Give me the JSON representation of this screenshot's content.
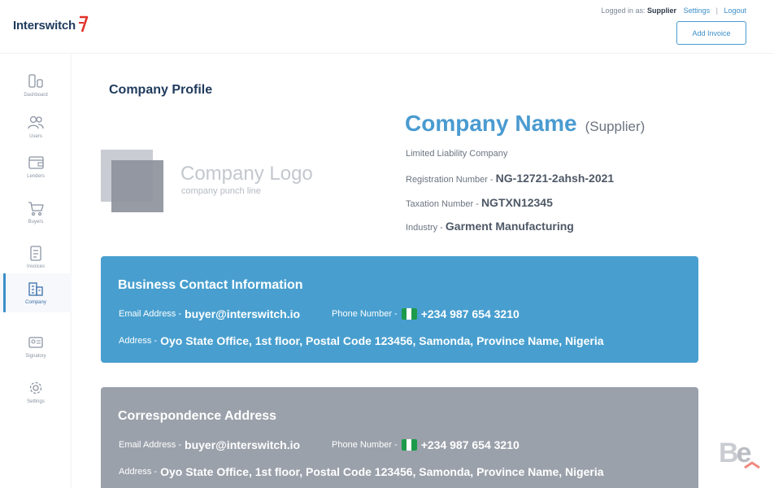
{
  "header": {
    "brand": "Interswitch",
    "logged_in_prefix": "Logged in as:",
    "user_role": "Supplier",
    "settings_link": "Settings",
    "separator": "|",
    "logout_link": "Logout",
    "add_invoice_label": "Add Invoice"
  },
  "sidebar": {
    "items": [
      {
        "label": "Dashboard",
        "icon": "dashboard-icon"
      },
      {
        "label": "Users",
        "icon": "users-icon"
      },
      {
        "label": "Lenders",
        "icon": "wallet-icon"
      },
      {
        "label": "Buyers",
        "icon": "cart-icon"
      },
      {
        "label": "Invoices",
        "icon": "clipboard-icon"
      },
      {
        "label": "Company",
        "icon": "building-icon",
        "active": true
      },
      {
        "label": "Signatory",
        "icon": "id-card-icon"
      },
      {
        "label": "Settings",
        "icon": "gear-icon"
      }
    ]
  },
  "main": {
    "page_title": "Company Profile",
    "logo_placeholder": {
      "title": "Company Logo",
      "subtitle": "company punch line"
    },
    "company": {
      "name": "Company Name",
      "role": "(Supplier)",
      "type": "Limited Liability Company",
      "registration_label": "Registration Number -",
      "registration_value": "NG-12721-2ahsh-2021",
      "taxation_label": "Taxation Number -",
      "taxation_value": "NGTXN12345",
      "industry_label": "Industry -",
      "industry_value": "Garment Manufacturing"
    },
    "business_contact": {
      "title": "Business Contact Information",
      "email_label": "Email Address -",
      "email_value": "buyer@interswitch.io",
      "phone_label": "Phone Number -",
      "phone_value": "+234 987 654 3210",
      "address_label": "Address -",
      "address_value": "Oyo State Office, 1st floor, Postal Code 123456, Samonda, Province Name, Nigeria"
    },
    "correspondence": {
      "title": "Correspondence Address",
      "email_label": "Email Address -",
      "email_value": "buyer@interswitch.io",
      "phone_label": "Phone Number -",
      "phone_value": "+234 987 654 3210",
      "address_label": "Address -",
      "address_value": "Oyo State Office, 1st floor, Postal Code 123456, Samonda, Province Name, Nigeria"
    }
  },
  "colors": {
    "accent": "#489fcf",
    "brand_navy": "#1f3a5c",
    "card_gray": "#9ba1ab",
    "brand_red": "#e2322b"
  }
}
